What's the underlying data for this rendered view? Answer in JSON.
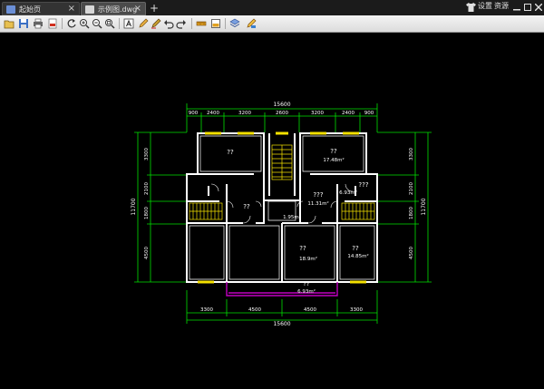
{
  "tabs": [
    {
      "label": "起始页",
      "close": "×"
    },
    {
      "label": "示例图.dwg",
      "close": "×"
    }
  ],
  "new_tab": "+",
  "window_controls": {
    "settings_label": "设置",
    "resources_label": "资源"
  },
  "drawing": {
    "top_overall": "15600",
    "top_segments": [
      "900",
      "2400",
      "3200",
      "2600",
      "3200",
      "2400",
      "900"
    ],
    "bottom_overall": "15600",
    "bottom_segments": [
      "3300",
      "4500",
      "4500",
      "3300"
    ],
    "left_overall": "11700",
    "left_segments": [
      "3300",
      "2100",
      "1800",
      "4500"
    ],
    "right_overall": "11700",
    "right_segments": [
      "3300",
      "2100",
      "1800",
      "4500"
    ],
    "rooms": [
      {
        "name": "??",
        "area": ""
      },
      {
        "name": "??",
        "area": "17.48m²"
      },
      {
        "name": "???",
        "area": "11.31m²"
      },
      {
        "name": "???",
        "area": ""
      },
      {
        "name": "",
        "area": "6.93m²"
      },
      {
        "name": "??",
        "area": ""
      },
      {
        "name": "",
        "area": "1.95m²"
      },
      {
        "name": "??",
        "area": "18.9m²"
      },
      {
        "name": "??",
        "area": "14.85m²"
      },
      {
        "name": "??",
        "area": "6.93m²"
      }
    ]
  },
  "colors": {
    "wall": "#ffffff",
    "dim": "#00e000",
    "window": "#f5e100",
    "balcony": "#c000c0",
    "stairs": "#f5e100"
  }
}
